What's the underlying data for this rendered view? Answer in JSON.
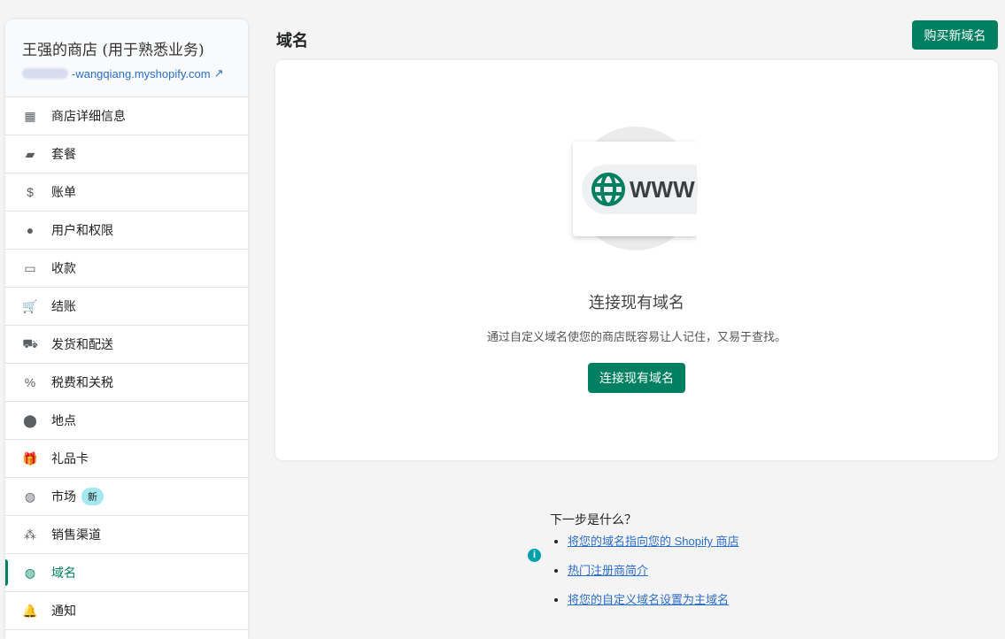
{
  "sidebar": {
    "store_name": "王强的商店 (用于熟悉业务)",
    "store_url": "-wangqiang.myshopify.com",
    "items": [
      {
        "label": "商店详细信息",
        "icon": "store-icon"
      },
      {
        "label": "套餐",
        "icon": "wallet-icon"
      },
      {
        "label": "账单",
        "icon": "receipt-icon"
      },
      {
        "label": "用户和权限",
        "icon": "user-icon"
      },
      {
        "label": "收款",
        "icon": "payment-card-icon"
      },
      {
        "label": "结账",
        "icon": "cart-icon"
      },
      {
        "label": "发货和配送",
        "icon": "truck-icon"
      },
      {
        "label": "税费和关税",
        "icon": "tax-icon"
      },
      {
        "label": "地点",
        "icon": "location-icon"
      },
      {
        "label": "礼品卡",
        "icon": "gift-icon"
      },
      {
        "label": "市场",
        "icon": "globe-icon",
        "badge": "新"
      },
      {
        "label": "销售渠道",
        "icon": "channels-icon"
      },
      {
        "label": "域名",
        "icon": "domain-globe-icon",
        "active": true
      },
      {
        "label": "通知",
        "icon": "bell-icon"
      }
    ]
  },
  "page": {
    "title": "域名",
    "buy_button": "购买新域名"
  },
  "card": {
    "illustration_text": "WWW",
    "title": "连接现有域名",
    "description": "通过自定义域名使您的商店既容易让人记住，又易于查找。",
    "button": "连接现有域名"
  },
  "next": {
    "heading": "下一步是什么？",
    "links": [
      "将您的域名指向您的 Shopify 商店",
      "热门注册商简介",
      "将您的自定义域名设置为主域名"
    ]
  }
}
